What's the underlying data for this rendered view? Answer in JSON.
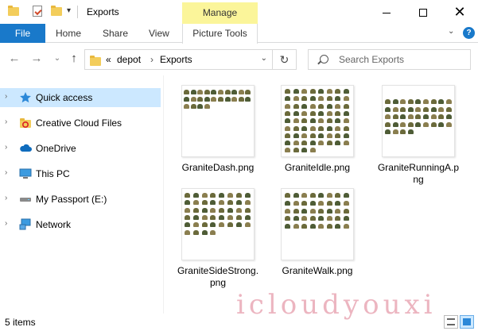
{
  "window": {
    "title": "Exports",
    "manage_tab": "Manage"
  },
  "ribbon": {
    "file": "File",
    "tabs": [
      "Home",
      "Share",
      "View"
    ],
    "picture_tools": "Picture Tools"
  },
  "address": {
    "overflow": "«",
    "crumbs": [
      "depot",
      "Exports"
    ],
    "separator": "›"
  },
  "search": {
    "placeholder": "Search Exports"
  },
  "nav": {
    "items": [
      {
        "label": "Quick access",
        "icon": "star-icon",
        "selected": true
      },
      {
        "label": "Creative Cloud Files",
        "icon": "creative-cloud-icon"
      },
      {
        "label": "OneDrive",
        "icon": "cloud-icon"
      },
      {
        "label": "This PC",
        "icon": "pc-icon"
      },
      {
        "label": "My Passport (E:)",
        "icon": "drive-icon"
      },
      {
        "label": "Network",
        "icon": "network-icon"
      }
    ]
  },
  "files": [
    {
      "name": "GraniteDash.png"
    },
    {
      "name": "GraniteIdle.png"
    },
    {
      "name": "GraniteRunningA.png"
    },
    {
      "name": "GraniteSideStrong.png"
    },
    {
      "name": "GraniteWalk.png"
    }
  ],
  "status": {
    "count": "5 items"
  },
  "watermark": "icloudyouxi",
  "colors": {
    "accent": "#1979ca",
    "manage": "#fbf59a",
    "selection": "#cce8ff"
  }
}
